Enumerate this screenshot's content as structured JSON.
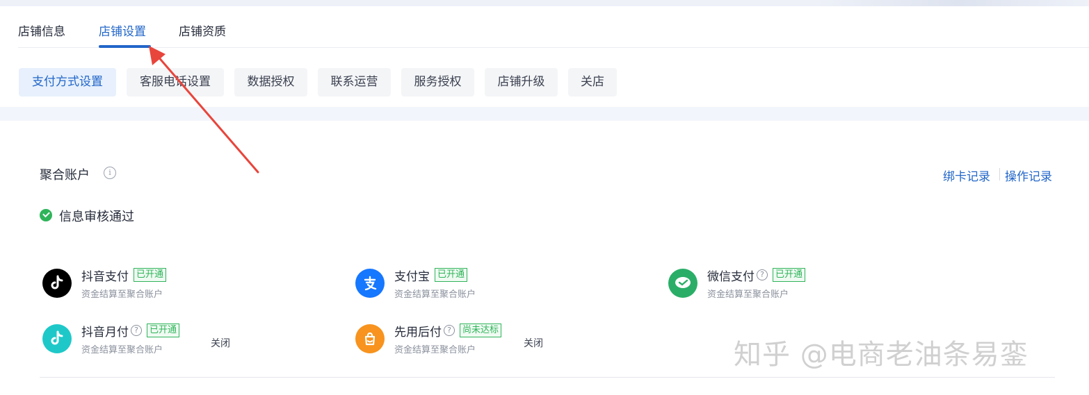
{
  "tabs": [
    {
      "label": "店铺信息",
      "active": false
    },
    {
      "label": "店铺设置",
      "active": true
    },
    {
      "label": "店铺资质",
      "active": false
    }
  ],
  "subtabs": [
    {
      "label": "支付方式设置",
      "active": true
    },
    {
      "label": "客服电话设置",
      "active": false
    },
    {
      "label": "数据授权",
      "active": false
    },
    {
      "label": "联系运营",
      "active": false
    },
    {
      "label": "服务授权",
      "active": false
    },
    {
      "label": "店铺升级",
      "active": false
    },
    {
      "label": "关店",
      "active": false
    }
  ],
  "section": {
    "title": "聚合账户",
    "info_icon": "i",
    "links": {
      "bind_card_record": "绑卡记录",
      "operation_record": "操作记录"
    },
    "status": "信息审核通过"
  },
  "payments": [
    {
      "name": "抖音支付",
      "desc": "资金结算至聚合账户",
      "badge": "已开通",
      "icon": "douyin-icon",
      "color": "#000000"
    },
    {
      "name": "支付宝",
      "desc": "资金结算至聚合账户",
      "badge": "已开通",
      "icon": "alipay-icon",
      "color": "#1677ff"
    },
    {
      "name": "微信支付",
      "desc": "资金结算至聚合账户",
      "badge": "已开通",
      "icon": "wechat-pay-icon",
      "color": "#2aae67"
    },
    {
      "name": "抖音月付",
      "desc": "资金结算至聚合账户",
      "badge": "已开通",
      "icon": "douyin-monthly-icon",
      "color": "#1ec8c8",
      "action": "关闭"
    },
    {
      "name": "先用后付",
      "desc": "资金结算至聚合账户",
      "badge": "尚未达标",
      "icon": "pay-later-icon",
      "color": "#f7931e",
      "action": "关闭"
    }
  ],
  "help_glyph": "?",
  "watermark": "知乎 @电商老油条易銮",
  "colors": {
    "accent": "#2266c9",
    "success": "#2fb45a",
    "annotation_arrow": "#e8453c"
  }
}
